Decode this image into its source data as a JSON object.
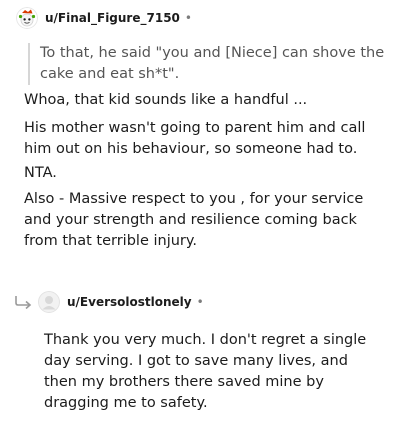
{
  "comment": {
    "username": "u/Final_Figure_7150",
    "separator": "•",
    "quote": "To that, he said \"you and [Niece] can shove the cake and eat sh*t\".",
    "paragraphs": [
      "Whoa, that kid sounds like a handful ...",
      "His mother wasn't going to parent him and call him out on his behaviour, so someone had to.",
      "NTA.",
      "Also - Massive respect to you , for your service and your strength and resilience coming back from that terrible injury."
    ]
  },
  "reply": {
    "username": "u/Eversolostlonely",
    "separator": "•",
    "text": "Thank you very much. I don't regret a single day serving. I got to save many lives, and then my brothers there saved mine by dragging me to safety."
  },
  "colors": {
    "quote_border": "#d6d6d6",
    "muted": "#7c7c7c",
    "avatar_red": "#d93a00",
    "avatar_green": "#46a508"
  },
  "icons": [
    "reddit-avatar-icon",
    "reply-arrow-icon",
    "default-avatar-icon"
  ]
}
